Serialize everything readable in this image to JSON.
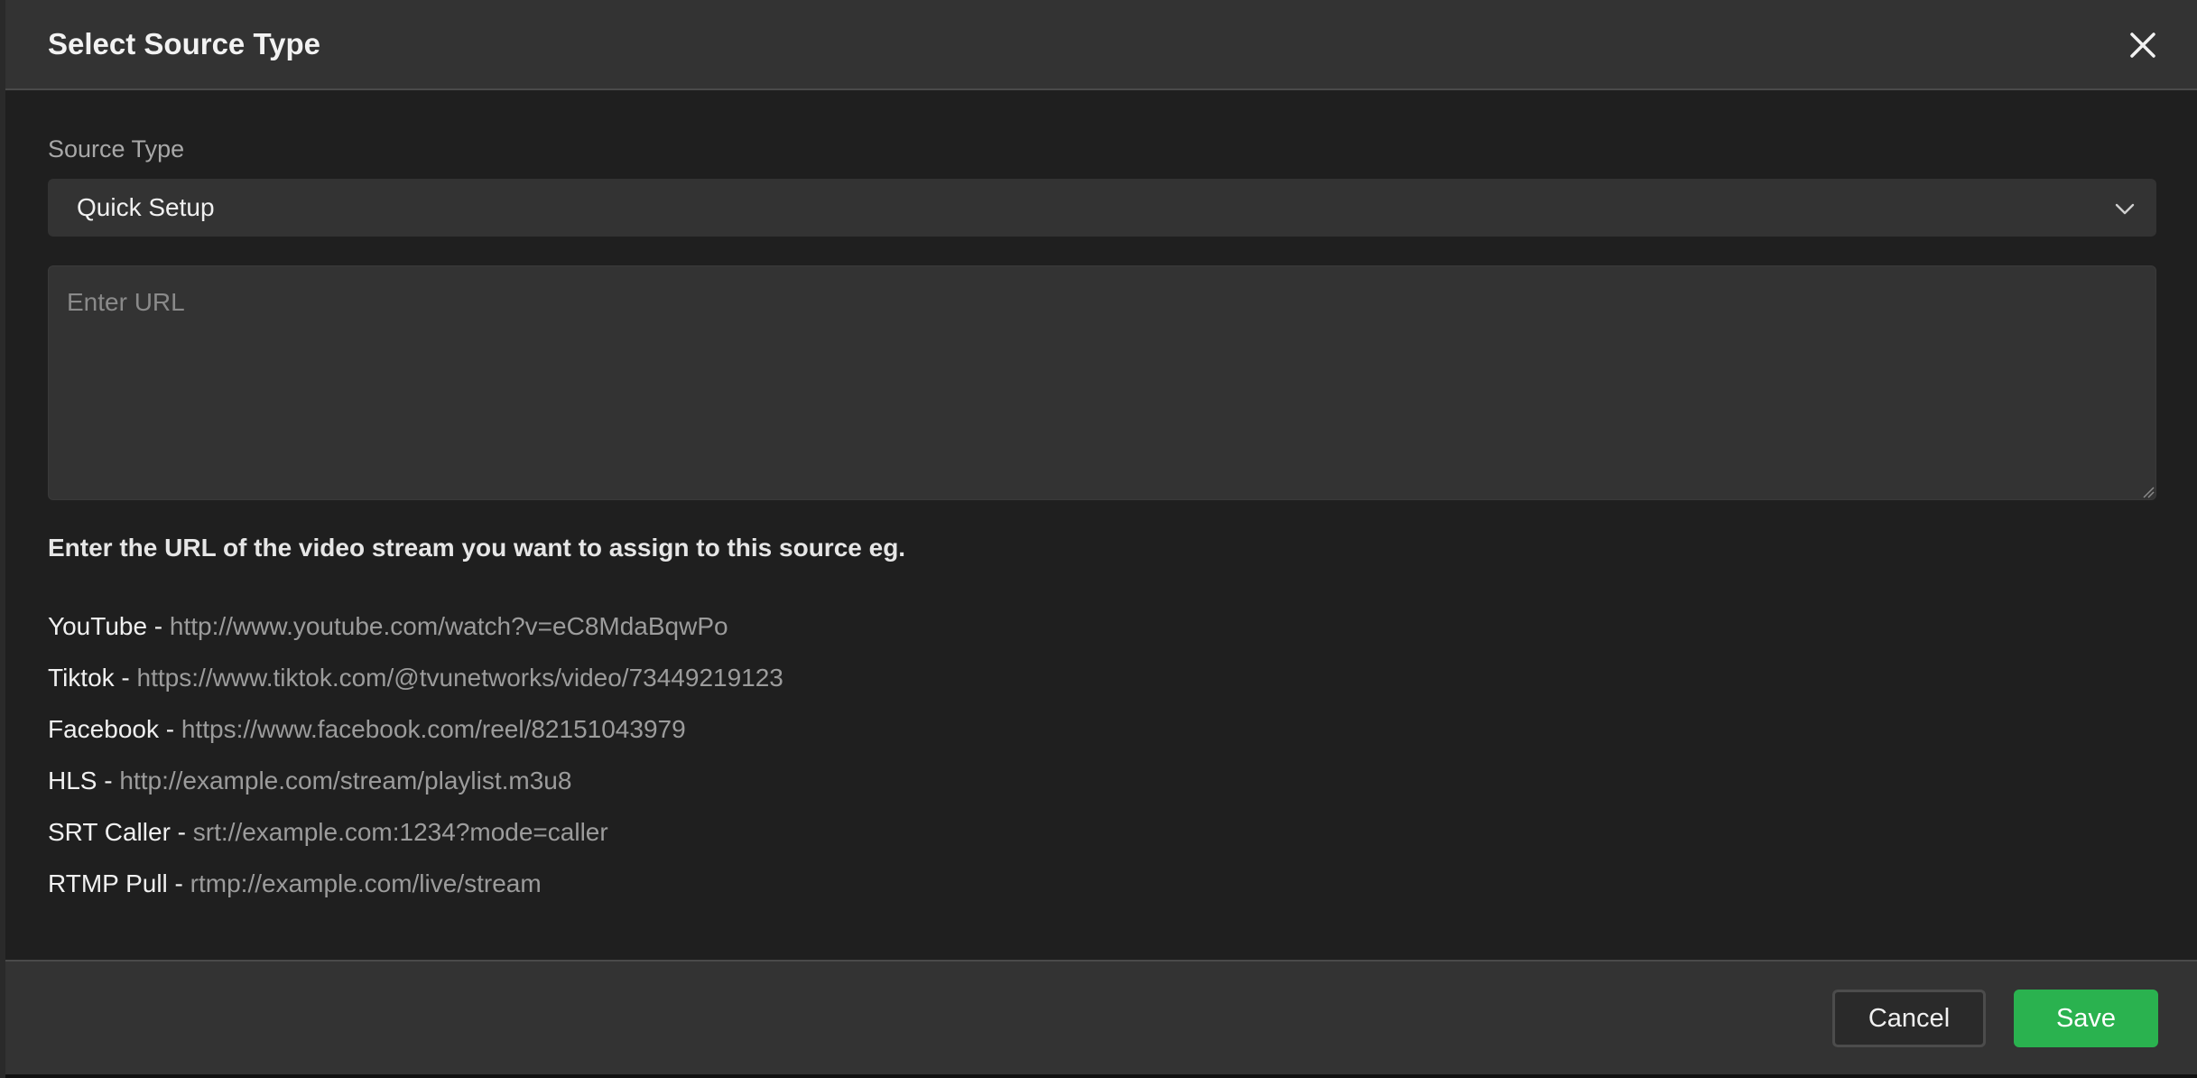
{
  "dialog": {
    "title": "Select Source Type",
    "close_icon": "close-icon"
  },
  "source_type": {
    "label": "Source Type",
    "selected": "Quick Setup",
    "chevron_icon": "chevron-down-icon"
  },
  "url_input": {
    "placeholder": "Enter URL",
    "value": ""
  },
  "help": {
    "title": "Enter the URL of the video stream you want to assign to this source eg.",
    "examples": [
      {
        "name": "YouTube",
        "url": "http://www.youtube.com/watch?v=eC8MdaBqwPo"
      },
      {
        "name": "Tiktok",
        "url": "https://www.tiktok.com/@tvunetworks/video/73449219123"
      },
      {
        "name": "Facebook",
        "url": "https://www.facebook.com/reel/82151043979"
      },
      {
        "name": "HLS",
        "url": "http://example.com/stream/playlist.m3u8"
      },
      {
        "name": "SRT Caller",
        "url": "srt://example.com:1234?mode=caller"
      },
      {
        "name": "RTMP Pull",
        "url": "rtmp://example.com/live/stream"
      }
    ]
  },
  "footer": {
    "cancel_label": "Cancel",
    "save_label": "Save"
  },
  "colors": {
    "save_green": "#2ab24f",
    "panel": "#333333",
    "background": "#1f1f1f"
  }
}
